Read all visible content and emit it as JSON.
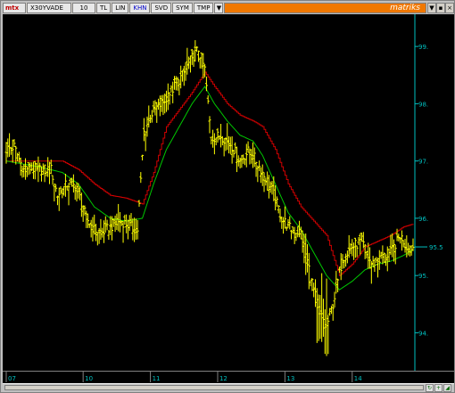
{
  "toolbar": {
    "logo": "mtx",
    "symbol": "X30YVADE",
    "period": "10",
    "buttons": [
      "TL",
      "LIN",
      "KHN",
      "SVD",
      "SYM",
      "TMP"
    ],
    "active_button": "KHN",
    "dropdown": "▼",
    "brand": "matriks",
    "window_buttons": [
      "▼",
      "▪",
      "×"
    ]
  },
  "colors": {
    "background": "#000000",
    "price_bars": "#ffff00",
    "moving_average": "#00c800",
    "envelope": "#d00000",
    "axis": "#00c0c0",
    "brand": "#f07800"
  },
  "chart_data": {
    "type": "ohlc",
    "y_ticks": [
      "99.",
      "98.",
      "97.",
      "96.",
      "95.",
      "94."
    ],
    "y_tick_values": [
      99,
      98,
      97,
      96,
      95,
      94
    ],
    "current_price_label": "95.5",
    "current_price": 95.5,
    "ylim": [
      93.4,
      99.5
    ],
    "x_ticks": [
      "07",
      "10",
      "11",
      "12",
      "13",
      "14"
    ],
    "x_tick_positions": [
      0,
      48,
      90,
      132,
      174,
      216
    ],
    "n_bars": 255,
    "price_path": [
      [
        0,
        97.2
      ],
      [
        5,
        97.25
      ],
      [
        10,
        96.9
      ],
      [
        20,
        96.85
      ],
      [
        28,
        96.85
      ],
      [
        32,
        96.4
      ],
      [
        38,
        96.6
      ],
      [
        44,
        96.55
      ],
      [
        50,
        96.0
      ],
      [
        55,
        95.8
      ],
      [
        60,
        95.75
      ],
      [
        65,
        95.85
      ],
      [
        72,
        95.95
      ],
      [
        78,
        95.85
      ],
      [
        82,
        95.8
      ],
      [
        86,
        97.5
      ],
      [
        90,
        97.8
      ],
      [
        95,
        97.95
      ],
      [
        100,
        98.1
      ],
      [
        105,
        98.3
      ],
      [
        110,
        98.5
      ],
      [
        116,
        98.8
      ],
      [
        120,
        98.95
      ],
      [
        124,
        98.6
      ],
      [
        128,
        97.4
      ],
      [
        134,
        97.45
      ],
      [
        140,
        97.3
      ],
      [
        146,
        97.0
      ],
      [
        152,
        97.2
      ],
      [
        156,
        97.0
      ],
      [
        160,
        96.8
      ],
      [
        166,
        96.5
      ],
      [
        172,
        96.0
      ],
      [
        178,
        95.8
      ],
      [
        184,
        95.75
      ],
      [
        190,
        95.0
      ],
      [
        195,
        94.4
      ],
      [
        200,
        94.1
      ],
      [
        204,
        94.5
      ],
      [
        210,
        95.3
      ],
      [
        216,
        95.5
      ],
      [
        222,
        95.6
      ],
      [
        228,
        95.2
      ],
      [
        234,
        95.3
      ],
      [
        240,
        95.4
      ],
      [
        246,
        95.7
      ],
      [
        250,
        95.5
      ],
      [
        254,
        95.5
      ]
    ],
    "moving_average_path": [
      [
        0,
        97.0
      ],
      [
        20,
        96.9
      ],
      [
        35,
        96.8
      ],
      [
        45,
        96.6
      ],
      [
        55,
        96.2
      ],
      [
        65,
        96.0
      ],
      [
        75,
        95.95
      ],
      [
        85,
        96.0
      ],
      [
        92,
        96.6
      ],
      [
        100,
        97.2
      ],
      [
        108,
        97.6
      ],
      [
        116,
        98.0
      ],
      [
        124,
        98.3
      ],
      [
        130,
        98.0
      ],
      [
        138,
        97.7
      ],
      [
        146,
        97.45
      ],
      [
        154,
        97.35
      ],
      [
        160,
        97.1
      ],
      [
        168,
        96.6
      ],
      [
        176,
        96.1
      ],
      [
        184,
        95.8
      ],
      [
        192,
        95.4
      ],
      [
        200,
        95.0
      ],
      [
        208,
        94.75
      ],
      [
        216,
        94.9
      ],
      [
        224,
        95.1
      ],
      [
        232,
        95.2
      ],
      [
        240,
        95.25
      ],
      [
        248,
        95.35
      ],
      [
        254,
        95.45
      ]
    ],
    "envelope_path": [
      [
        0,
        97.0
      ],
      [
        20,
        97.0
      ],
      [
        35,
        97.0
      ],
      [
        45,
        96.85
      ],
      [
        55,
        96.6
      ],
      [
        65,
        96.4
      ],
      [
        75,
        96.35
      ],
      [
        85,
        96.25
      ],
      [
        92,
        96.8
      ],
      [
        100,
        97.6
      ],
      [
        108,
        97.9
      ],
      [
        116,
        98.2
      ],
      [
        124,
        98.55
      ],
      [
        130,
        98.3
      ],
      [
        138,
        98.0
      ],
      [
        146,
        97.8
      ],
      [
        154,
        97.7
      ],
      [
        160,
        97.6
      ],
      [
        168,
        97.2
      ],
      [
        176,
        96.6
      ],
      [
        184,
        96.2
      ],
      [
        192,
        95.95
      ],
      [
        200,
        95.7
      ],
      [
        208,
        95.0
      ],
      [
        216,
        95.2
      ],
      [
        224,
        95.5
      ],
      [
        232,
        95.6
      ],
      [
        240,
        95.7
      ],
      [
        248,
        95.85
      ],
      [
        254,
        95.9
      ]
    ]
  }
}
